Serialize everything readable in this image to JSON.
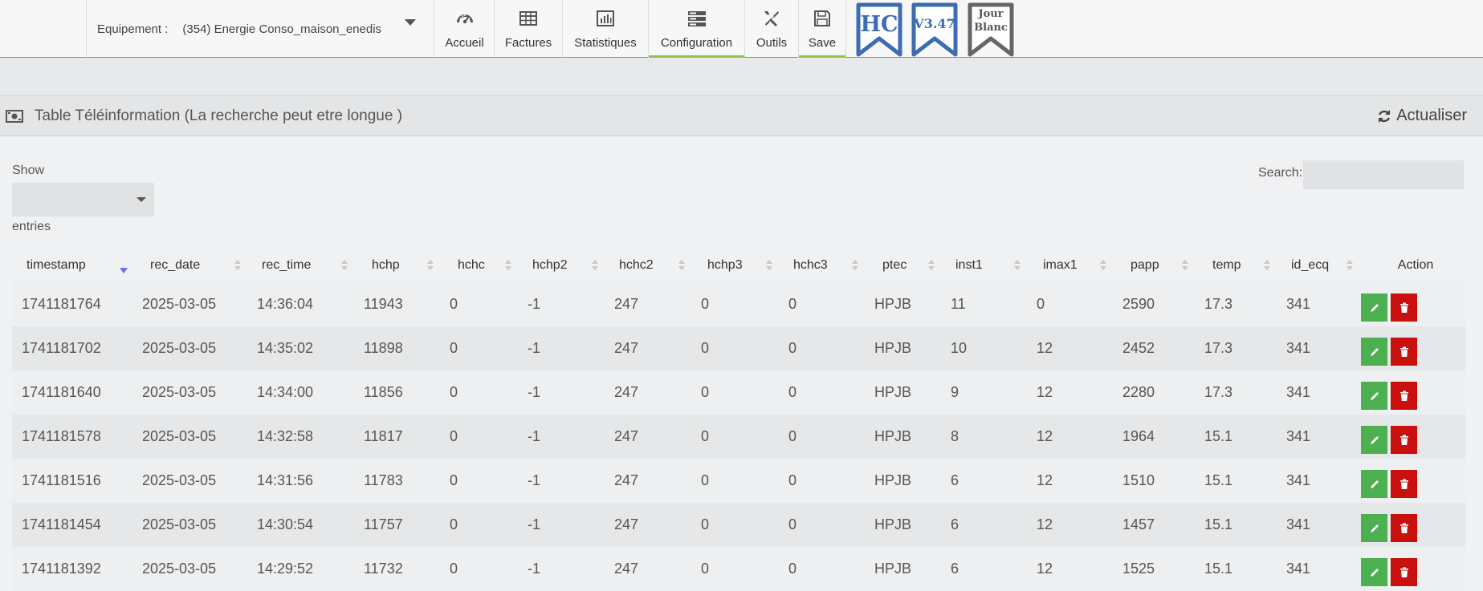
{
  "header": {
    "equipment_label": "Equipement :",
    "equipment_value": "(354) Energie Conso_maison_enedis",
    "nav": [
      {
        "label": "Accueil",
        "icon": "dashboard-icon"
      },
      {
        "label": "Factures",
        "icon": "table-icon"
      },
      {
        "label": "Statistiques",
        "icon": "bar-chart-icon"
      },
      {
        "label": "Configuration",
        "icon": "server-icon"
      },
      {
        "label": "Outils",
        "icon": "wrench-icon"
      },
      {
        "label": "Save",
        "icon": "floppy-icon"
      }
    ],
    "badges": [
      {
        "text": "HC",
        "color": "#3d6cb3"
      },
      {
        "text": "V3.47",
        "color": "#3d6cb3"
      },
      {
        "text_line1": "Jour",
        "text_line2": "Blanc",
        "color": "#666666"
      }
    ]
  },
  "panel": {
    "title": "Table Téléinformation (La recherche peut etre longue )",
    "refresh_label": "Actualiser"
  },
  "controls": {
    "show_label": "Show",
    "entries_label": "entries",
    "search_label": "Search:",
    "search_value": ""
  },
  "table": {
    "columns": [
      "timestamp",
      "rec_date",
      "rec_time",
      "hchp",
      "hchc",
      "hchp2",
      "hchc2",
      "hchp3",
      "hchc3",
      "ptec",
      "inst1",
      "imax1",
      "papp",
      "temp",
      "id_ecq",
      "Action"
    ],
    "rows": [
      [
        "1741181764",
        "2025-03-05",
        "14:36:04",
        "11943",
        "0",
        "-1",
        "247",
        "0",
        "0",
        "HPJB",
        "11",
        "0",
        "2590",
        "17.3",
        "341"
      ],
      [
        "1741181702",
        "2025-03-05",
        "14:35:02",
        "11898",
        "0",
        "-1",
        "247",
        "0",
        "0",
        "HPJB",
        "10",
        "12",
        "2452",
        "17.3",
        "341"
      ],
      [
        "1741181640",
        "2025-03-05",
        "14:34:00",
        "11856",
        "0",
        "-1",
        "247",
        "0",
        "0",
        "HPJB",
        "9",
        "12",
        "2280",
        "17.3",
        "341"
      ],
      [
        "1741181578",
        "2025-03-05",
        "14:32:58",
        "11817",
        "0",
        "-1",
        "247",
        "0",
        "0",
        "HPJB",
        "8",
        "12",
        "1964",
        "15.1",
        "341"
      ],
      [
        "1741181516",
        "2025-03-05",
        "14:31:56",
        "11783",
        "0",
        "-1",
        "247",
        "0",
        "0",
        "HPJB",
        "6",
        "12",
        "1510",
        "15.1",
        "341"
      ],
      [
        "1741181454",
        "2025-03-05",
        "14:30:54",
        "11757",
        "0",
        "-1",
        "247",
        "0",
        "0",
        "HPJB",
        "6",
        "12",
        "1457",
        "15.1",
        "341"
      ],
      [
        "1741181392",
        "2025-03-05",
        "14:29:52",
        "11732",
        "0",
        "-1",
        "247",
        "0",
        "0",
        "HPJB",
        "6",
        "12",
        "1525",
        "15.1",
        "341"
      ]
    ]
  },
  "colors": {
    "edit_button": "#4caf50",
    "delete_button": "#c9100f",
    "active_tab_underline": "#8bc34a"
  }
}
